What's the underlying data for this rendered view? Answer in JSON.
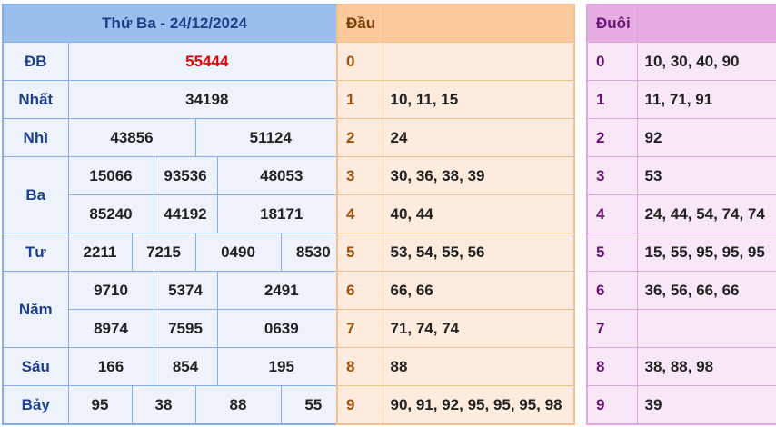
{
  "results": {
    "title": "Thứ Ba - 24/12/2024",
    "colors": {
      "special": "#e00000",
      "label": "#1d3f8a",
      "header_bg": "#99c0ef"
    },
    "db": {
      "label": "ĐB",
      "value": "55444"
    },
    "nhat": {
      "label": "Nhất",
      "value": "34198"
    },
    "nhi": {
      "label": "Nhì",
      "values": [
        "43856",
        "51124"
      ]
    },
    "ba": {
      "label": "Ba",
      "values": [
        "15066",
        "93536",
        "48053",
        "85240",
        "44192",
        "18171"
      ]
    },
    "tu": {
      "label": "Tư",
      "values": [
        "2211",
        "7215",
        "0490",
        "8530"
      ]
    },
    "nam": {
      "label": "Năm",
      "values": [
        "9710",
        "5374",
        "2491",
        "8974",
        "7595",
        "0639"
      ]
    },
    "sau": {
      "label": "Sáu",
      "values": [
        "166",
        "854",
        "195"
      ]
    },
    "bay": {
      "label": "Bảy",
      "values": [
        "95",
        "38",
        "88",
        "55"
      ]
    }
  },
  "head": {
    "title": "Đầu",
    "rows": [
      {
        "digit": "0",
        "nums": ""
      },
      {
        "digit": "1",
        "nums": "10, 11, 15"
      },
      {
        "digit": "2",
        "nums": "24"
      },
      {
        "digit": "3",
        "nums": "30, 36, 38, 39"
      },
      {
        "digit": "4",
        "nums": "40, 44"
      },
      {
        "digit": "5",
        "nums": "53, 54, 55, 56"
      },
      {
        "digit": "6",
        "nums": "66, 66"
      },
      {
        "digit": "7",
        "nums": "71, 74, 74"
      },
      {
        "digit": "8",
        "nums": "88"
      },
      {
        "digit": "9",
        "nums": "90, 91, 92, 95, 95, 95, 98"
      }
    ]
  },
  "tail": {
    "title": "Đuôi",
    "rows": [
      {
        "digit": "0",
        "nums": "10, 30, 40, 90"
      },
      {
        "digit": "1",
        "nums": "11, 71, 91"
      },
      {
        "digit": "2",
        "nums": "92"
      },
      {
        "digit": "3",
        "nums": "53"
      },
      {
        "digit": "4",
        "nums": "24, 44, 54, 74, 74"
      },
      {
        "digit": "5",
        "nums": "15, 55, 95, 95, 95"
      },
      {
        "digit": "6",
        "nums": "36, 56, 66, 66"
      },
      {
        "digit": "7",
        "nums": ""
      },
      {
        "digit": "8",
        "nums": "38, 88, 98"
      },
      {
        "digit": "9",
        "nums": "39"
      }
    ]
  }
}
